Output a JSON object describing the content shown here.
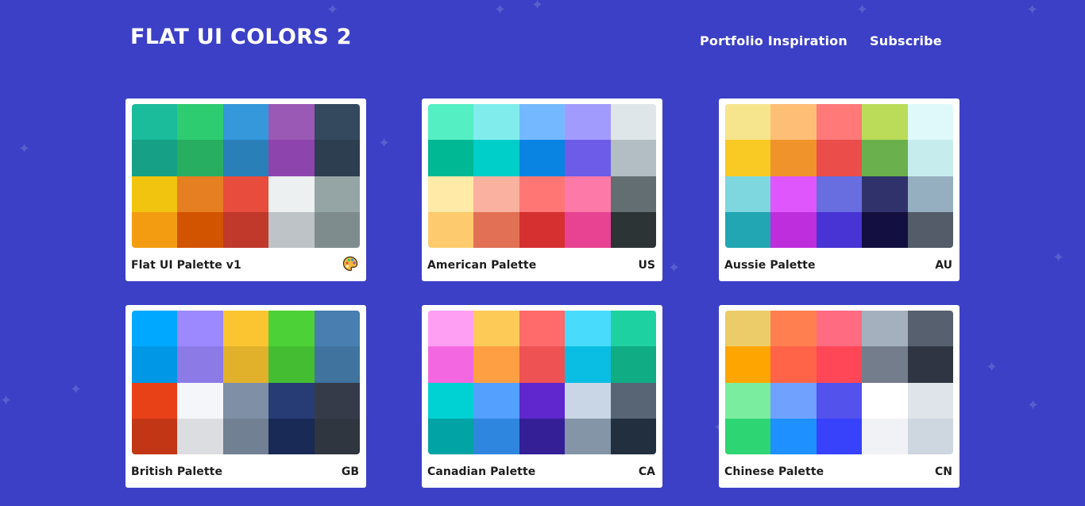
{
  "header": {
    "brand": "FLAT UI COLORS 2",
    "nav": [
      {
        "label": "Portfolio Inspiration"
      },
      {
        "label": "Subscribe"
      }
    ]
  },
  "palettes": [
    {
      "name": "Flat UI Palette v1",
      "code": "",
      "icon": "palette-icon",
      "colors": [
        "#1abc9c",
        "#2ecc71",
        "#3498db",
        "#9b59b6",
        "#34495e",
        "#16a085",
        "#27ae60",
        "#2980b9",
        "#8e44ad",
        "#2c3e50",
        "#f1c40f",
        "#e67e22",
        "#e74c3c",
        "#ecf0f1",
        "#95a5a6",
        "#f39c12",
        "#d35400",
        "#c0392b",
        "#bdc3c7",
        "#7f8c8d"
      ]
    },
    {
      "name": "American Palette",
      "code": "US",
      "colors": [
        "#55efc4",
        "#81ecec",
        "#74b9ff",
        "#a29bfe",
        "#dfe6e9",
        "#00b894",
        "#00cec9",
        "#0984e3",
        "#6c5ce7",
        "#b2bec3",
        "#ffeaa7",
        "#fab1a0",
        "#ff7675",
        "#fd79a8",
        "#636e72",
        "#fdcb6e",
        "#e17055",
        "#d63031",
        "#e84393",
        "#2d3436"
      ]
    },
    {
      "name": "Aussie Palette",
      "code": "AU",
      "colors": [
        "#f6e58d",
        "#ffbe76",
        "#ff7979",
        "#badc58",
        "#dff9fb",
        "#f9ca24",
        "#f0932b",
        "#eb4d4b",
        "#6ab04c",
        "#c7ecee",
        "#7ed6df",
        "#e056fd",
        "#686de0",
        "#30336b",
        "#95afc0",
        "#22a6b3",
        "#be2edd",
        "#4834d4",
        "#130f40",
        "#535c68"
      ]
    },
    {
      "name": "British Palette",
      "code": "GB",
      "colors": [
        "#00a8ff",
        "#9c88ff",
        "#fbc531",
        "#4cd137",
        "#487eb0",
        "#0097e6",
        "#8c7ae6",
        "#e1b12c",
        "#44bd32",
        "#40739e",
        "#e84118",
        "#f5f6fa",
        "#7f8fa6",
        "#273c75",
        "#353b48",
        "#c23616",
        "#dcdde1",
        "#718093",
        "#192a56",
        "#2f3640"
      ]
    },
    {
      "name": "Canadian Palette",
      "code": "CA",
      "colors": [
        "#ff9ff3",
        "#feca57",
        "#ff6b6b",
        "#48dbfb",
        "#1dd1a1",
        "#f368e0",
        "#ff9f43",
        "#ee5253",
        "#0abde3",
        "#10ac84",
        "#00d2d3",
        "#54a0ff",
        "#5f27cd",
        "#c8d6e5",
        "#576574",
        "#01a3a4",
        "#2e86de",
        "#341f97",
        "#8395a7",
        "#222f3e"
      ]
    },
    {
      "name": "Chinese Palette",
      "code": "CN",
      "colors": [
        "#eccc68",
        "#ff7f50",
        "#ff6b81",
        "#a4b0be",
        "#57606f",
        "#ffa502",
        "#ff6348",
        "#ff4757",
        "#747d8c",
        "#2f3542",
        "#7bed9f",
        "#70a1ff",
        "#5352ed",
        "#ffffff",
        "#dfe4ea",
        "#2ed573",
        "#1e90ff",
        "#3742fa",
        "#f1f2f6",
        "#ced6e0"
      ]
    }
  ],
  "theme": {
    "background": "#3c40c6",
    "sparkle": "#575fcf"
  }
}
